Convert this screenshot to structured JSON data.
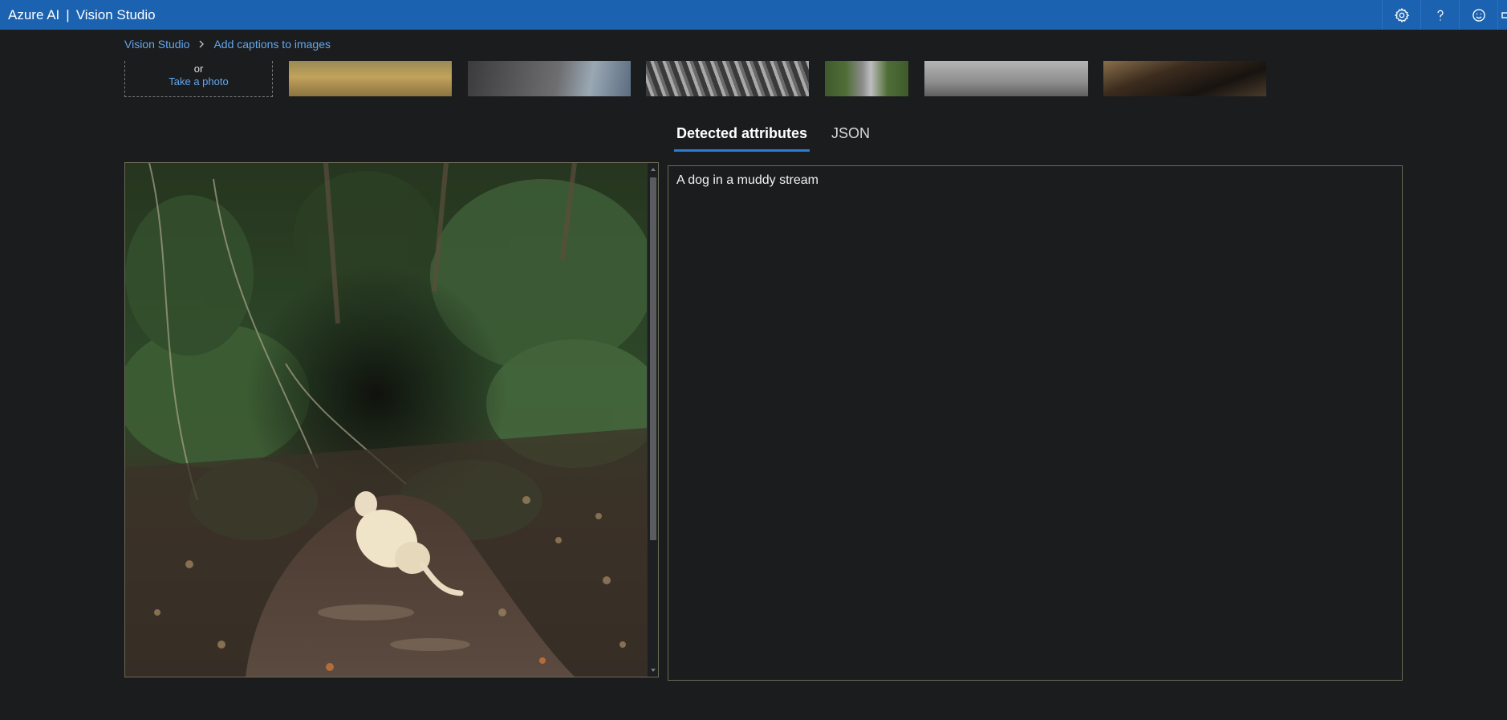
{
  "app": {
    "brand": "Azure AI",
    "separator": "|",
    "product": "Vision Studio"
  },
  "header_actions": [
    {
      "icon": "gear-icon"
    },
    {
      "icon": "help-icon"
    },
    {
      "icon": "smiley-icon"
    }
  ],
  "breadcrumb": {
    "root": "Vision Studio",
    "current": "Add captions to images"
  },
  "upload": {
    "or_text": "or",
    "take_photo": "Take a photo"
  },
  "samples": [
    "sample-field",
    "sample-rocky-coast",
    "sample-stone-carving",
    "sample-baseball",
    "sample-skateboard",
    "sample-dark-still-life"
  ],
  "tabs": {
    "detected": "Detected attributes",
    "json": "JSON",
    "active": "detected"
  },
  "result": {
    "caption": "A dog in a muddy stream"
  },
  "colors": {
    "topbar": "#1b62b0",
    "background": "#1b1c1e",
    "link": "#62a8f0",
    "tab_underline": "#2b7cd3"
  }
}
